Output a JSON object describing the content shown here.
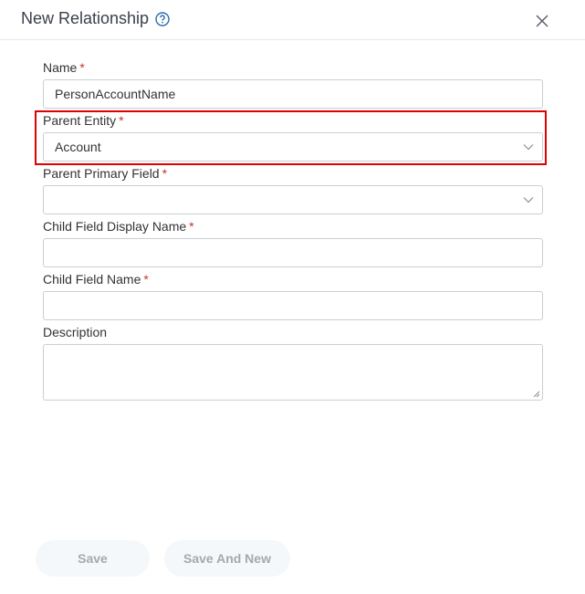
{
  "dialog": {
    "title": "New Relationship",
    "help_icon": "question-circle-icon",
    "close_icon": "close-x-icon"
  },
  "form": {
    "required_marker": "*",
    "name": {
      "label": "Name",
      "required": true,
      "value": "PersonAccountName"
    },
    "parent_entity": {
      "label": "Parent Entity",
      "required": true,
      "value": "Account",
      "icon": "chevron-down-icon",
      "highlighted": true
    },
    "parent_primary_field": {
      "label": "Parent Primary Field",
      "required": true,
      "value": "",
      "icon": "chevron-down-icon"
    },
    "child_field_display_name": {
      "label": "Child Field Display Name",
      "required": true,
      "value": ""
    },
    "child_field_name": {
      "label": "Child Field Name",
      "required": true,
      "value": ""
    },
    "description": {
      "label": "Description",
      "required": false,
      "value": ""
    }
  },
  "footer": {
    "save_label": "Save",
    "save_and_new_label": "Save And New"
  },
  "colors": {
    "highlight": "#e00000",
    "required": "#c0392b",
    "accent": "#2b6cb0",
    "button_bg": "#f4f8fa",
    "button_text": "#a8a8a8"
  }
}
